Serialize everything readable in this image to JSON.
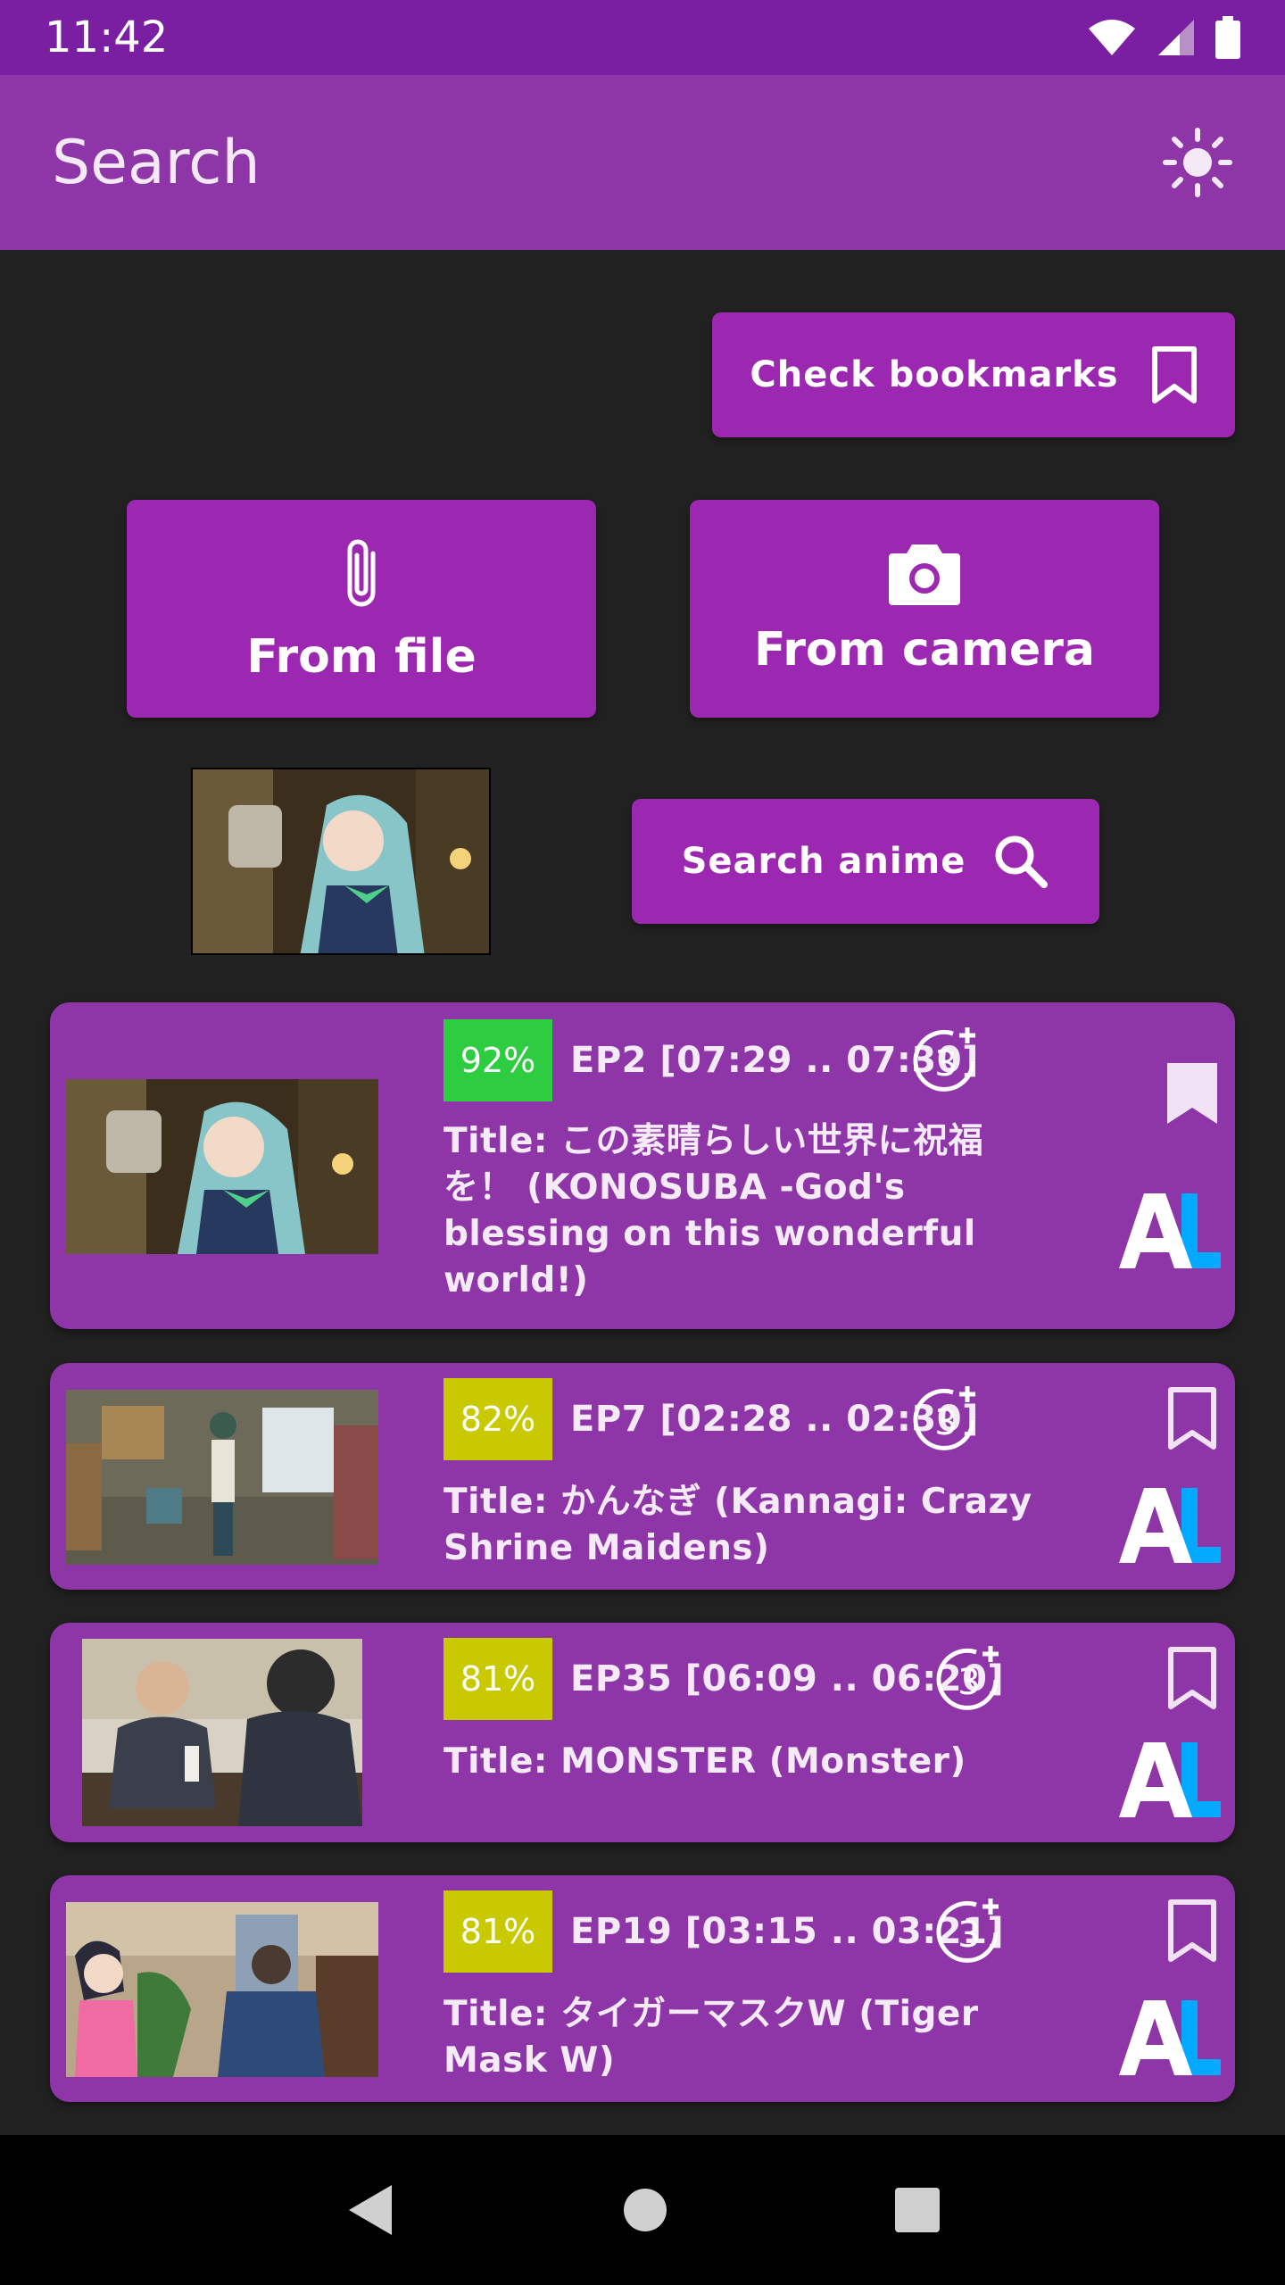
{
  "status_bar": {
    "time": "11:42"
  },
  "app_bar": {
    "title": "Search",
    "theme_icon": "brightness-icon"
  },
  "buttons": {
    "check_bookmarks": "Check bookmarks",
    "from_file": "From file",
    "from_camera": "From camera",
    "search_anime": "Search anime"
  },
  "results": [
    {
      "similarity": "92%",
      "similarity_color": "#2ecc40",
      "episode": "EP2  [07:29 .. 07:30]",
      "title": "Title: この素晴らしい世界に祝福を！ (KONOSUBA -God's blessing on this wonderful world!)",
      "bookmarked": true
    },
    {
      "similarity": "82%",
      "similarity_color": "#c9c900",
      "episode": "EP7  [02:28 .. 02:30]",
      "title": "Title: かんなぎ (Kannagi: Crazy Shrine Maidens)",
      "bookmarked": false
    },
    {
      "similarity": "81%",
      "similarity_color": "#c9c900",
      "episode": "EP35  [06:09 .. 06:20]",
      "title": "Title: MONSTER (Monster)",
      "bookmarked": false
    },
    {
      "similarity": "81%",
      "similarity_color": "#c9c900",
      "episode": "EP19  [03:15 .. 03:21]",
      "title": "Title: タイガーマスクW (Tiger Mask W)",
      "bookmarked": false
    }
  ],
  "colors": {
    "primary": "#9c27b0",
    "app_bar": "#8e35a7",
    "status_bar": "#7b1fa2",
    "background": "#212121"
  }
}
